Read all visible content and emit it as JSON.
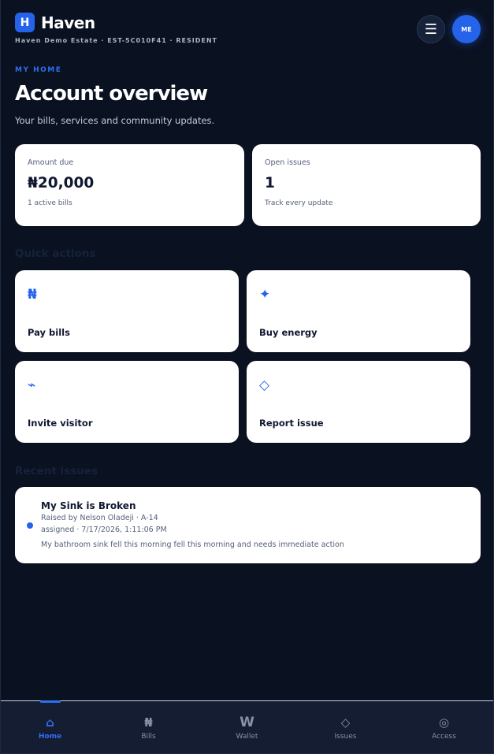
{
  "header": {
    "logo_letter": "H",
    "app_name": "Haven",
    "estate_line": "Haven Demo Estate · EST-5C010F41 · RESIDENT",
    "menu_glyph": "☰",
    "avatar_initials": "ME"
  },
  "intro": {
    "eyebrow": "MY HOME",
    "title": "Account overview",
    "subtitle": "Your bills, services and community updates."
  },
  "stats": [
    {
      "label": "Amount due",
      "value": "₦20,000",
      "note": "1 active bills"
    },
    {
      "label": "Open issues",
      "value": "1",
      "note": "Track every update"
    }
  ],
  "quick_actions": {
    "title": "Quick actions",
    "items": [
      {
        "label": "Pay bills",
        "icon": "naira-icon",
        "glyph": "₦"
      },
      {
        "label": "Buy energy",
        "icon": "sparkle-icon",
        "glyph": "✦"
      },
      {
        "label": "Invite visitor",
        "icon": "lightning-icon",
        "glyph": "⌁"
      },
      {
        "label": "Report issue",
        "icon": "diamond-icon",
        "glyph": "◇"
      }
    ]
  },
  "recent_issues": {
    "title": "Recent issues",
    "items": [
      {
        "title": "My Sink is Broken",
        "raised_by": "Raised by Nelson Oladeji · A-14",
        "status_line": "assigned · 7/17/2026, 1:11:06 PM",
        "description": "My bathroom sink fell this morning fell this morning and needs immediate action"
      }
    ]
  },
  "bottom_nav": {
    "items": [
      {
        "label": "Home",
        "glyph": "⌂",
        "icon": "home-icon",
        "active": true
      },
      {
        "label": "Bills",
        "glyph": "₦",
        "icon": "naira-icon",
        "active": false
      },
      {
        "label": "Wallet",
        "glyph": "W",
        "icon": "wallet-icon",
        "active": false
      },
      {
        "label": "Issues",
        "glyph": "◇",
        "icon": "diamond-icon",
        "active": false
      },
      {
        "label": "Access",
        "glyph": "◎",
        "icon": "access-icon",
        "active": false
      }
    ]
  },
  "colors": {
    "background": "#0a1120",
    "accent": "#2563eb",
    "card": "#ffffff",
    "nav_background": "#141d31"
  }
}
